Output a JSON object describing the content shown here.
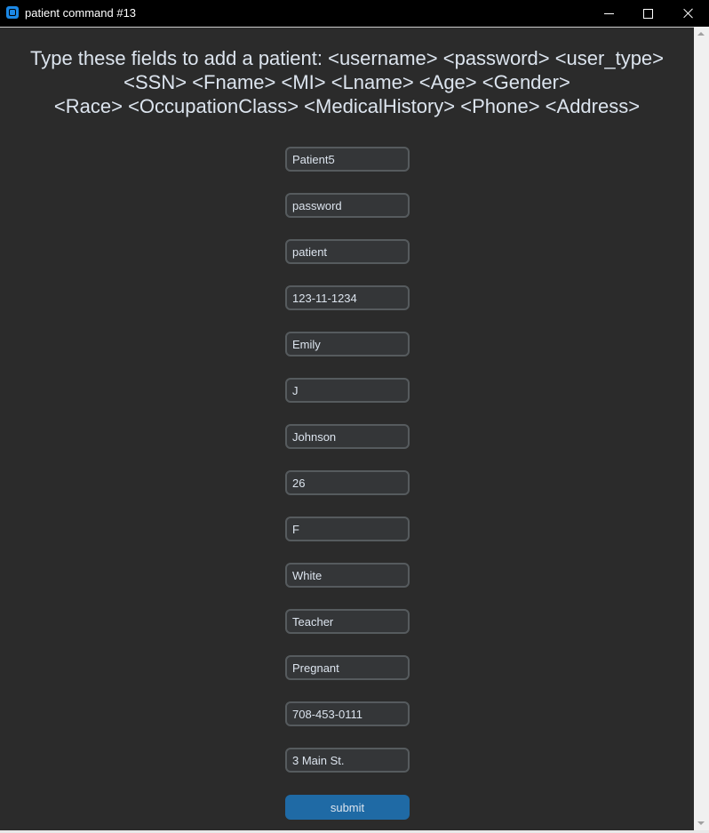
{
  "window": {
    "title": "patient command #13",
    "icon": "app-window-icon"
  },
  "heading": {
    "lines": [
      "Type these fields to add a patient: <username> <password> <user_type>",
      "<SSN> <Fname> <MI> <Lname> <Age> <Gender>",
      "<Race> <OccupationClass> <MedicalHistory> <Phone> <Address>"
    ]
  },
  "fields": [
    {
      "name": "username",
      "value": "Patient5"
    },
    {
      "name": "password",
      "value": "password"
    },
    {
      "name": "user-type",
      "value": "patient"
    },
    {
      "name": "ssn",
      "value": "123-11-1234"
    },
    {
      "name": "fname",
      "value": "Emily"
    },
    {
      "name": "mi",
      "value": "J"
    },
    {
      "name": "lname",
      "value": "Johnson"
    },
    {
      "name": "age",
      "value": "26"
    },
    {
      "name": "gender",
      "value": "F"
    },
    {
      "name": "race",
      "value": "White"
    },
    {
      "name": "occupation-class",
      "value": "Teacher"
    },
    {
      "name": "medical-history",
      "value": "Pregnant"
    },
    {
      "name": "phone",
      "value": "708-453-0111"
    },
    {
      "name": "address",
      "value": "3 Main St."
    }
  ],
  "submit": {
    "label": "submit"
  },
  "colors": {
    "background": "#2b2b2b",
    "field_bg": "#343638",
    "field_border": "#565b5e",
    "button": "#1f6aa5",
    "text": "#dce4ee"
  }
}
